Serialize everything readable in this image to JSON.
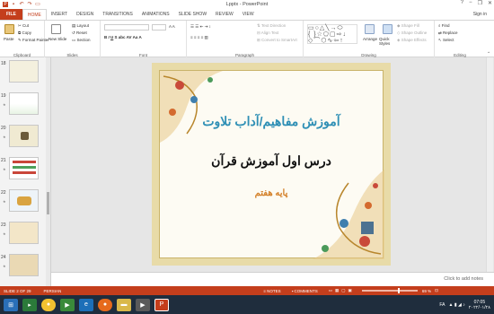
{
  "window": {
    "title": "Lpptx - PowerPoint",
    "controls": [
      "?",
      "−",
      "❐",
      "✕"
    ]
  },
  "tabs": [
    "FILE",
    "HOME",
    "INSERT",
    "DESIGN",
    "TRANSITIONS",
    "ANIMATIONS",
    "SLIDE SHOW",
    "REVIEW",
    "VIEW"
  ],
  "active_tab": "HOME",
  "sign_in": "Sign in",
  "ribbon": {
    "clipboard": {
      "paste": "Paste",
      "cut": "Cut",
      "copy": "Copy",
      "format_painter": "Format Painter",
      "label": "Clipboard"
    },
    "slides": {
      "new_slide": "New Slide",
      "layout": "Layout",
      "reset": "Reset",
      "section": "Section",
      "label": "Slides"
    },
    "font": {
      "label": "Font"
    },
    "paragraph": {
      "text_direction": "Text Direction",
      "align_text": "Align Text",
      "convert_smartart": "Convert to SmartArt",
      "label": "Paragraph"
    },
    "drawing": {
      "arrange": "Arrange",
      "quick_styles": "Quick Styles",
      "shape_fill": "Shape Fill",
      "shape_outline": "Shape Outline",
      "shape_effects": "Shape Effects",
      "label": "Drawing"
    },
    "editing": {
      "find": "Find",
      "replace": "Replace",
      "select": "Select",
      "label": "Editing"
    }
  },
  "thumbnails": [
    {
      "num": "18"
    },
    {
      "num": "19"
    },
    {
      "num": "20"
    },
    {
      "num": "21"
    },
    {
      "num": "22"
    },
    {
      "num": "23"
    },
    {
      "num": "24"
    }
  ],
  "slide": {
    "title": "آموزش مفاهیم/آداب تلاوت",
    "subtitle": "درس اول آموزش قرآن",
    "grade": "پایه هفتم"
  },
  "notes_placeholder": "Click to add notes",
  "status": {
    "slide_info": "SLIDE 2 OF 29",
    "language": "PERSIAN",
    "notes": "NOTES",
    "comments": "COMMENTS",
    "zoom": "69 %"
  },
  "taskbar": {
    "lang": "FA",
    "time": "07:05",
    "date": "۲۰۲۲/۰۱/۲۸"
  },
  "colors": {
    "accent": "#c43e1c",
    "taskbar": "#1f2d3d",
    "slide_title": "#2e8fb5",
    "slide_grade": "#d4812a"
  }
}
